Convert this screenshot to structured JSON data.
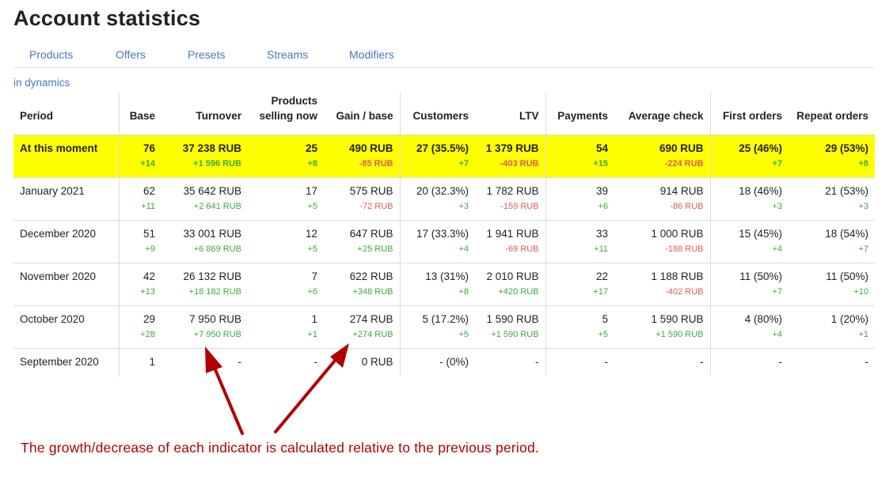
{
  "page": {
    "title": "Account statistics"
  },
  "tabs": [
    "Products",
    "Offers",
    "Presets",
    "Streams",
    "Modifiers"
  ],
  "dynamics_link": "in dynamics",
  "table": {
    "headers": {
      "period": "Period",
      "base": "Base",
      "turnover": "Turnover",
      "products_1": "Products",
      "products_2": "selling now",
      "gain": "Gain / base",
      "customers": "Customers",
      "ltv": "LTV",
      "payments": "Payments",
      "avg_check": "Average check",
      "first_orders": "First orders",
      "repeat_orders": "Repeat orders"
    },
    "rows": [
      {
        "period": "At this moment",
        "base": "76",
        "base_d": "+14",
        "turnover": "37 238 RUB",
        "turnover_d": "+1 596 RUB",
        "products": "25",
        "products_d": "+8",
        "gain": "490 RUB",
        "gain_d": "-85 RUB",
        "customers": "27 (35.5%)",
        "customers_d": "+7",
        "ltv": "1 379 RUB",
        "ltv_d": "-403 RUB",
        "payments": "54",
        "payments_d": "+15",
        "avg_check": "690 RUB",
        "avg_check_d": "-224 RUB",
        "first_orders": "25 (46%)",
        "first_orders_d": "+7",
        "repeat_orders": "29 (53%)",
        "repeat_orders_d": "+8"
      },
      {
        "period": "January 2021",
        "base": "62",
        "base_d": "+11",
        "turnover": "35 642 RUB",
        "turnover_d": "+2 641 RUB",
        "products": "17",
        "products_d": "+5",
        "gain": "575 RUB",
        "gain_d": "-72 RUB",
        "customers": "20 (32.3%)",
        "customers_d": "+3",
        "ltv": "1 782 RUB",
        "ltv_d": "-159 RUB",
        "payments": "39",
        "payments_d": "+6",
        "avg_check": "914 RUB",
        "avg_check_d": "-86 RUB",
        "first_orders": "18 (46%)",
        "first_orders_d": "+3",
        "repeat_orders": "21 (53%)",
        "repeat_orders_d": "+3"
      },
      {
        "period": "December 2020",
        "base": "51",
        "base_d": "+9",
        "turnover": "33 001 RUB",
        "turnover_d": "+6 869 RUB",
        "products": "12",
        "products_d": "+5",
        "gain": "647 RUB",
        "gain_d": "+25 RUB",
        "customers": "17 (33.3%)",
        "customers_d": "+4",
        "ltv": "1 941 RUB",
        "ltv_d": "-69 RUB",
        "payments": "33",
        "payments_d": "+11",
        "avg_check": "1 000 RUB",
        "avg_check_d": "-188 RUB",
        "first_orders": "15 (45%)",
        "first_orders_d": "+4",
        "repeat_orders": "18 (54%)",
        "repeat_orders_d": "+7"
      },
      {
        "period": "November 2020",
        "base": "42",
        "base_d": "+13",
        "turnover": "26 132 RUB",
        "turnover_d": "+18 182 RUB",
        "products": "7",
        "products_d": "+6",
        "gain": "622 RUB",
        "gain_d": "+348 RUB",
        "customers": "13 (31%)",
        "customers_d": "+8",
        "ltv": "2 010 RUB",
        "ltv_d": "+420 RUB",
        "payments": "22",
        "payments_d": "+17",
        "avg_check": "1 188 RUB",
        "avg_check_d": "-402 RUB",
        "first_orders": "11 (50%)",
        "first_orders_d": "+7",
        "repeat_orders": "11 (50%)",
        "repeat_orders_d": "+10"
      },
      {
        "period": "October 2020",
        "base": "29",
        "base_d": "+28",
        "turnover": "7 950 RUB",
        "turnover_d": "+7 950 RUB",
        "products": "1",
        "products_d": "+1",
        "gain": "274 RUB",
        "gain_d": "+274 RUB",
        "customers": "5 (17.2%)",
        "customers_d": "+5",
        "ltv": "1 590 RUB",
        "ltv_d": "+1 590 RUB",
        "payments": "5",
        "payments_d": "+5",
        "avg_check": "1 590 RUB",
        "avg_check_d": "+1 590 RUB",
        "first_orders": "4 (80%)",
        "first_orders_d": "+4",
        "repeat_orders": "1 (20%)",
        "repeat_orders_d": "+1"
      },
      {
        "period": "September 2020",
        "base": "1",
        "base_d": "",
        "turnover": "-",
        "turnover_d": "",
        "products": "-",
        "products_d": "",
        "gain": "0 RUB",
        "gain_d": "",
        "customers": "- (0%)",
        "customers_d": "",
        "ltv": "-",
        "ltv_d": "",
        "payments": "-",
        "payments_d": "",
        "avg_check": "-",
        "avg_check_d": "",
        "first_orders": "-",
        "first_orders_d": "",
        "repeat_orders": "-",
        "repeat_orders_d": ""
      }
    ]
  },
  "annotation": "The growth/decrease of each indicator is calculated relative to the previous period.",
  "colors": {
    "highlight": "#ffff00",
    "positive": "#3bab3b",
    "negative": "#e05a5a",
    "link": "#4a78b8",
    "annotation": "#b00000"
  }
}
